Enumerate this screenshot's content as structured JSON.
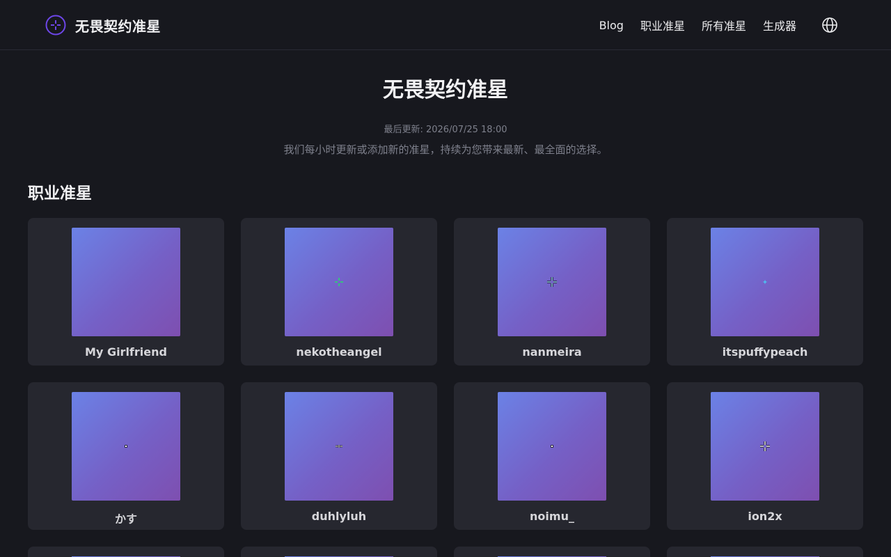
{
  "header": {
    "brand": "无畏契约准星",
    "nav": [
      "Blog",
      "职业准星",
      "所有准星",
      "生成器"
    ],
    "language_icon": "globe-icon",
    "brand_icon": "crosshair-icon"
  },
  "hero": {
    "title": "无畏契约准星",
    "updated": "最后更新: 2026/07/25 18:00",
    "description": "我们每小时更新或添加新的准星，持续为您带来最新、最全面的选择。"
  },
  "section": {
    "title": "职业准星"
  },
  "cards": [
    {
      "name": "My Girlfriend",
      "crosshair": "none",
      "color": "#00ff00"
    },
    {
      "name": "nekotheangel",
      "crosshair": "plus",
      "color": "#22e06a"
    },
    {
      "name": "nanmeira",
      "crosshair": "outlined-plus",
      "color": "#9ad8ff"
    },
    {
      "name": "itspuffypeach",
      "crosshair": "small-plus",
      "color": "#3fe0ff"
    },
    {
      "name": "かす",
      "crosshair": "dot",
      "color": "#ffffff"
    },
    {
      "name": "duhlyluh",
      "crosshair": "gap-plus",
      "color": "#ffffff"
    },
    {
      "name": "noimu_",
      "crosshair": "dot",
      "color": "#ffffff"
    },
    {
      "name": "ion2x",
      "crosshair": "outlined-plus",
      "color": "#ffffff"
    }
  ],
  "colors": {
    "background": "#17181e",
    "card": "#26272f",
    "accent": "#7c4dff"
  }
}
